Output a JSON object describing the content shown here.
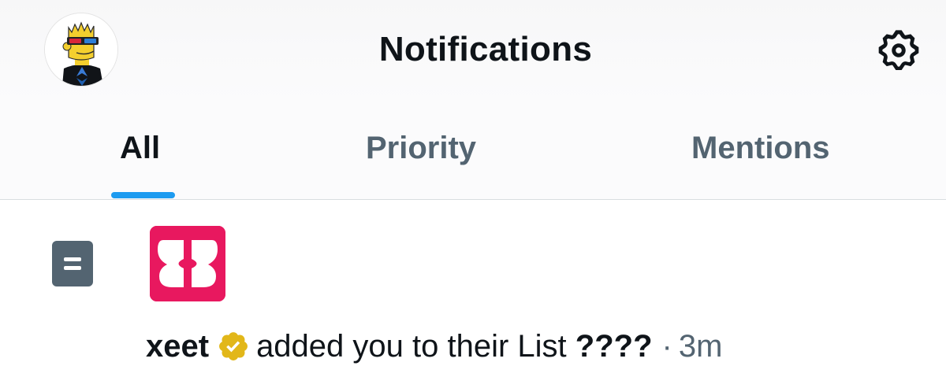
{
  "header": {
    "title": "Notifications",
    "avatar_icon": "bart-simpson-avatar",
    "settings_icon": "gear-icon"
  },
  "tabs": [
    {
      "label": "All",
      "active": true
    },
    {
      "label": "Priority",
      "active": false
    },
    {
      "label": "Mentions",
      "active": false
    }
  ],
  "colors": {
    "accent": "#1d9bf0",
    "text_primary": "#0f1419",
    "text_secondary": "#536471",
    "app_logo": "#e8185f",
    "verified_gold": "#e2b719"
  },
  "notification": {
    "type_icon": "list-icon",
    "app_logo_icon": "xeet-logo-icon",
    "actor_name": "xeet",
    "verified": true,
    "action_text": "added you to their List",
    "list_name": "????",
    "separator": "·",
    "time": "3m"
  }
}
